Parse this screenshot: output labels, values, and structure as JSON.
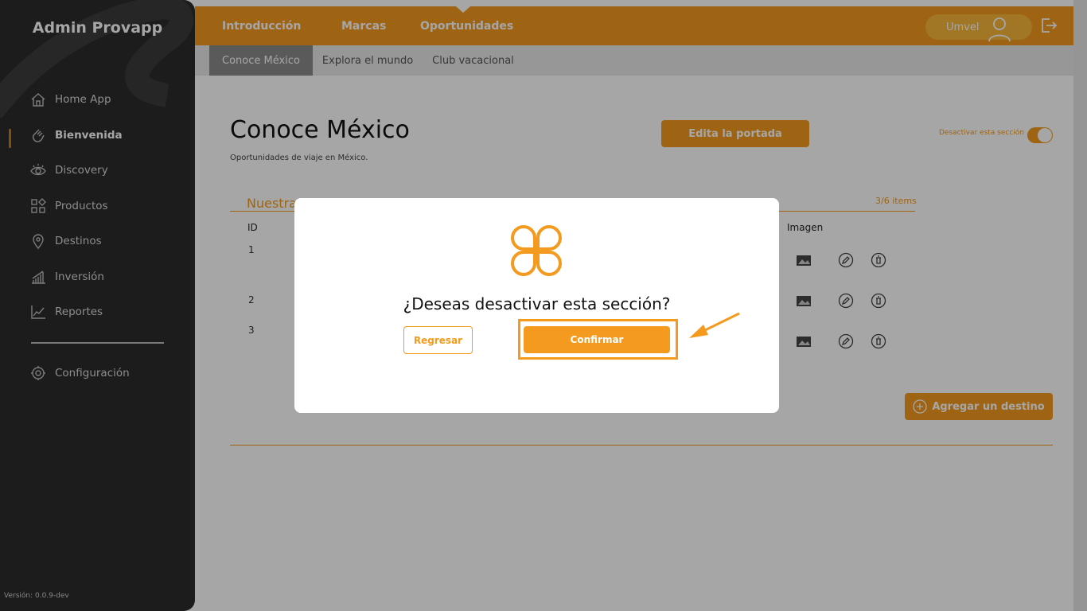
{
  "sidebar": {
    "brand": "Admin Provapp",
    "items": [
      {
        "label": "Home App",
        "icon": "home-icon"
      },
      {
        "label": "Bienvenida",
        "icon": "wave-hand-icon"
      },
      {
        "label": "Discovery",
        "icon": "eye-icon"
      },
      {
        "label": "Productos",
        "icon": "grid-icon"
      },
      {
        "label": "Destinos",
        "icon": "map-pin-icon"
      },
      {
        "label": "Inversión",
        "icon": "bar-chart-icon"
      },
      {
        "label": "Reportes",
        "icon": "line-chart-icon"
      }
    ],
    "active_item": "Bienvenida",
    "config_label": "Configuración",
    "version": "Versión: 0.0.9-dev"
  },
  "topbar": {
    "tabs": [
      "Introducción",
      "Marcas",
      "Oportunidades"
    ],
    "active_tab": "Oportunidades",
    "user_name": "Umvel"
  },
  "subtabs": {
    "items": [
      "Conoce México",
      "Explora el mundo",
      "Club vacacional"
    ],
    "active": "Conoce México"
  },
  "page": {
    "title": "Conoce México",
    "subtitle": "Oportunidades de viaje en México.",
    "edit_cover_label": "Edita la portada",
    "toggle_label": "Desactivar esta sección",
    "toggle_on": true,
    "section_title": "Nuestra",
    "section_count": "3/6 items",
    "columns": {
      "id": "ID",
      "image": "Imagen"
    },
    "rows": [
      {
        "id": "1"
      },
      {
        "id": "2"
      },
      {
        "id": "3"
      }
    ],
    "add_label": "Agregar un destino"
  },
  "modal": {
    "question": "¿Deseas desactivar esta sección?",
    "back_label": "Regresar",
    "confirm_label": "Confirmar"
  },
  "colors": {
    "accent": "#f39a1f",
    "sidebar_bg": "#2b2b2b"
  }
}
